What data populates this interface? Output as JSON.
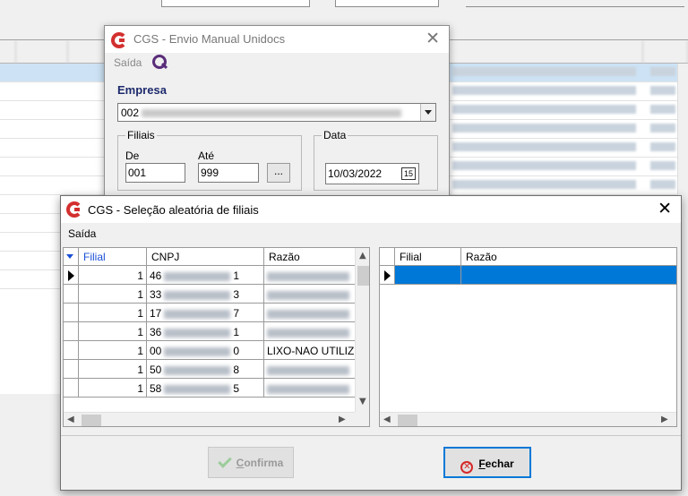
{
  "window1": {
    "title": "CGS - Envio Manual Unidocs",
    "menu_exit": "Saída",
    "empresa_label": "Empresa",
    "empresa_value": "002",
    "filiais_label": "Filiais",
    "de_label": "De",
    "de_value": "001",
    "ate_label": "Até",
    "ate_value": "999",
    "dots_label": "...",
    "data_label": "Data",
    "data_value": "10/03/2022",
    "calendar_glyph": "15"
  },
  "window2": {
    "title": "CGS - Seleção aleatória de filiais",
    "menu_exit": "Saída",
    "left_grid": {
      "headers": [
        "Filial",
        "CNPJ",
        "Razão"
      ],
      "rows": [
        {
          "filial": "1",
          "cnpj_start": "46",
          "cnpj_end": "1",
          "razao": ""
        },
        {
          "filial": "1",
          "cnpj_start": "33",
          "cnpj_end": "3",
          "razao": ""
        },
        {
          "filial": "1",
          "cnpj_start": "17",
          "cnpj_end": "7",
          "razao": ""
        },
        {
          "filial": "1",
          "cnpj_start": "36",
          "cnpj_end": "1",
          "razao": ""
        },
        {
          "filial": "1",
          "cnpj_start": "00",
          "cnpj_end": "0",
          "razao": "LIXO-NAO UTILIZ"
        },
        {
          "filial": "1",
          "cnpj_start": "50",
          "cnpj_end": "8",
          "razao": ""
        },
        {
          "filial": "1",
          "cnpj_start": "58",
          "cnpj_end": "5",
          "razao": ""
        }
      ]
    },
    "right_grid": {
      "headers": [
        "Filial",
        "Razão"
      ]
    },
    "confirm_button": {
      "first": "C",
      "rest": "onfirma"
    },
    "close_button": {
      "first": "F",
      "rest": "echar"
    }
  },
  "colors": {
    "selection": "#0078d7",
    "header_sort": "#1a4fd6",
    "empresa_label": "#1d2a6c",
    "logo": "#d32f2f"
  },
  "icons": [
    "cgs-logo-icon",
    "search-icon",
    "close-icon",
    "calendar-icon",
    "sort-desc-icon",
    "row-indicator-icon",
    "check-icon",
    "close-circle-icon",
    "dropdown-arrow-icon"
  ]
}
